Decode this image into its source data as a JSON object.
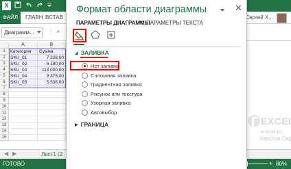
{
  "excel": {
    "logo_text": "X",
    "quick_access": [
      "save-icon",
      "undo-icon",
      "redo-icon",
      "customize-icon"
    ],
    "file_tab": "ФАЙЛ",
    "tabs": [
      "ГЛАВН",
      "ВСТАВ"
    ],
    "user": "Сергей Х...",
    "name_box": "Диаграмм...",
    "columns": [
      "A",
      "B"
    ],
    "rows": [
      {
        "num": "1",
        "a": "Категория",
        "b": "Сумма"
      },
      {
        "num": "2",
        "a": "SKU_01",
        "b": "7 328,00"
      },
      {
        "num": "3",
        "a": "SKU_02",
        "b": "6 180,00"
      },
      {
        "num": "4",
        "a": "SKU_03",
        "b": "113 000,00"
      },
      {
        "num": "5",
        "a": "SKU_04",
        "b": "9 375,00"
      },
      {
        "num": "6",
        "a": "SKU_05",
        "b": "5 536,00"
      },
      {
        "num": "7",
        "a": "",
        "b": ""
      },
      {
        "num": "8",
        "a": "",
        "b": ""
      },
      {
        "num": "9",
        "a": "",
        "b": ""
      },
      {
        "num": "10",
        "a": "",
        "b": ""
      },
      {
        "num": "11",
        "a": "",
        "b": ""
      },
      {
        "num": "12",
        "a": "",
        "b": ""
      },
      {
        "num": "13",
        "a": "",
        "b": ""
      },
      {
        "num": "14",
        "a": "",
        "b": ""
      },
      {
        "num": "15",
        "a": "",
        "b": ""
      }
    ],
    "sheet_tab": "Лист1 (2",
    "status": "ГОТОВО",
    "zoom": "80%",
    "accent": "#217346"
  },
  "pane": {
    "title": "Формат области диаграммы",
    "option_tabs": {
      "chart": "ПАРАМЕТРЫ ДИАГРАММЫ",
      "text": "ПАРАМЕТРЫ ТЕКСТА"
    },
    "category_icons": [
      "fill-line-icon",
      "effects-pentagon-icon",
      "size-properties-icon"
    ],
    "fill_section": "ЗАЛИВКА",
    "fill_options": [
      {
        "label": "Нет заливки",
        "checked": true
      },
      {
        "label": "Сплошная заливка",
        "checked": false
      },
      {
        "label": "Градиентная заливка",
        "checked": false
      },
      {
        "label": "Рисунок или текстура",
        "checked": false
      },
      {
        "label": "Узорная заливка",
        "checked": false
      },
      {
        "label": "Автовыбор",
        "checked": false
      }
    ],
    "border_section": "ГРАНИЦА",
    "highlight_color": "#e00000"
  },
  "watermark": {
    "brand": "EXCEL.RU",
    "site": "e-xcel.ru",
    "author": "Хвостов Сергей"
  }
}
